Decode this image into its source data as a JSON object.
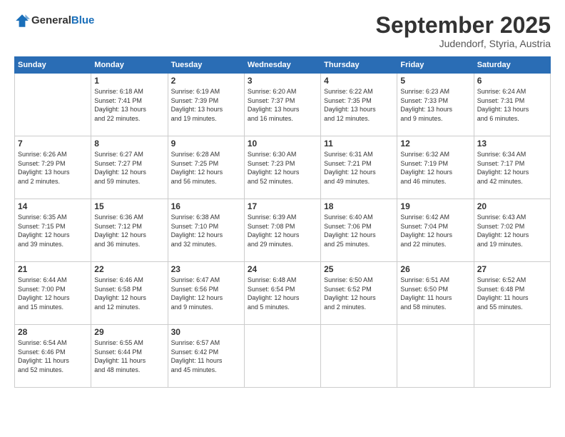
{
  "logo": {
    "general": "General",
    "blue": "Blue"
  },
  "header": {
    "month": "September 2025",
    "location": "Judendorf, Styria, Austria"
  },
  "weekdays": [
    "Sunday",
    "Monday",
    "Tuesday",
    "Wednesday",
    "Thursday",
    "Friday",
    "Saturday"
  ],
  "weeks": [
    [
      {
        "day": "",
        "info": ""
      },
      {
        "day": "1",
        "info": "Sunrise: 6:18 AM\nSunset: 7:41 PM\nDaylight: 13 hours\nand 22 minutes."
      },
      {
        "day": "2",
        "info": "Sunrise: 6:19 AM\nSunset: 7:39 PM\nDaylight: 13 hours\nand 19 minutes."
      },
      {
        "day": "3",
        "info": "Sunrise: 6:20 AM\nSunset: 7:37 PM\nDaylight: 13 hours\nand 16 minutes."
      },
      {
        "day": "4",
        "info": "Sunrise: 6:22 AM\nSunset: 7:35 PM\nDaylight: 13 hours\nand 12 minutes."
      },
      {
        "day": "5",
        "info": "Sunrise: 6:23 AM\nSunset: 7:33 PM\nDaylight: 13 hours\nand 9 minutes."
      },
      {
        "day": "6",
        "info": "Sunrise: 6:24 AM\nSunset: 7:31 PM\nDaylight: 13 hours\nand 6 minutes."
      }
    ],
    [
      {
        "day": "7",
        "info": "Sunrise: 6:26 AM\nSunset: 7:29 PM\nDaylight: 13 hours\nand 2 minutes."
      },
      {
        "day": "8",
        "info": "Sunrise: 6:27 AM\nSunset: 7:27 PM\nDaylight: 12 hours\nand 59 minutes."
      },
      {
        "day": "9",
        "info": "Sunrise: 6:28 AM\nSunset: 7:25 PM\nDaylight: 12 hours\nand 56 minutes."
      },
      {
        "day": "10",
        "info": "Sunrise: 6:30 AM\nSunset: 7:23 PM\nDaylight: 12 hours\nand 52 minutes."
      },
      {
        "day": "11",
        "info": "Sunrise: 6:31 AM\nSunset: 7:21 PM\nDaylight: 12 hours\nand 49 minutes."
      },
      {
        "day": "12",
        "info": "Sunrise: 6:32 AM\nSunset: 7:19 PM\nDaylight: 12 hours\nand 46 minutes."
      },
      {
        "day": "13",
        "info": "Sunrise: 6:34 AM\nSunset: 7:17 PM\nDaylight: 12 hours\nand 42 minutes."
      }
    ],
    [
      {
        "day": "14",
        "info": "Sunrise: 6:35 AM\nSunset: 7:15 PM\nDaylight: 12 hours\nand 39 minutes."
      },
      {
        "day": "15",
        "info": "Sunrise: 6:36 AM\nSunset: 7:12 PM\nDaylight: 12 hours\nand 36 minutes."
      },
      {
        "day": "16",
        "info": "Sunrise: 6:38 AM\nSunset: 7:10 PM\nDaylight: 12 hours\nand 32 minutes."
      },
      {
        "day": "17",
        "info": "Sunrise: 6:39 AM\nSunset: 7:08 PM\nDaylight: 12 hours\nand 29 minutes."
      },
      {
        "day": "18",
        "info": "Sunrise: 6:40 AM\nSunset: 7:06 PM\nDaylight: 12 hours\nand 25 minutes."
      },
      {
        "day": "19",
        "info": "Sunrise: 6:42 AM\nSunset: 7:04 PM\nDaylight: 12 hours\nand 22 minutes."
      },
      {
        "day": "20",
        "info": "Sunrise: 6:43 AM\nSunset: 7:02 PM\nDaylight: 12 hours\nand 19 minutes."
      }
    ],
    [
      {
        "day": "21",
        "info": "Sunrise: 6:44 AM\nSunset: 7:00 PM\nDaylight: 12 hours\nand 15 minutes."
      },
      {
        "day": "22",
        "info": "Sunrise: 6:46 AM\nSunset: 6:58 PM\nDaylight: 12 hours\nand 12 minutes."
      },
      {
        "day": "23",
        "info": "Sunrise: 6:47 AM\nSunset: 6:56 PM\nDaylight: 12 hours\nand 9 minutes."
      },
      {
        "day": "24",
        "info": "Sunrise: 6:48 AM\nSunset: 6:54 PM\nDaylight: 12 hours\nand 5 minutes."
      },
      {
        "day": "25",
        "info": "Sunrise: 6:50 AM\nSunset: 6:52 PM\nDaylight: 12 hours\nand 2 minutes."
      },
      {
        "day": "26",
        "info": "Sunrise: 6:51 AM\nSunset: 6:50 PM\nDaylight: 11 hours\nand 58 minutes."
      },
      {
        "day": "27",
        "info": "Sunrise: 6:52 AM\nSunset: 6:48 PM\nDaylight: 11 hours\nand 55 minutes."
      }
    ],
    [
      {
        "day": "28",
        "info": "Sunrise: 6:54 AM\nSunset: 6:46 PM\nDaylight: 11 hours\nand 52 minutes."
      },
      {
        "day": "29",
        "info": "Sunrise: 6:55 AM\nSunset: 6:44 PM\nDaylight: 11 hours\nand 48 minutes."
      },
      {
        "day": "30",
        "info": "Sunrise: 6:57 AM\nSunset: 6:42 PM\nDaylight: 11 hours\nand 45 minutes."
      },
      {
        "day": "",
        "info": ""
      },
      {
        "day": "",
        "info": ""
      },
      {
        "day": "",
        "info": ""
      },
      {
        "day": "",
        "info": ""
      }
    ]
  ]
}
